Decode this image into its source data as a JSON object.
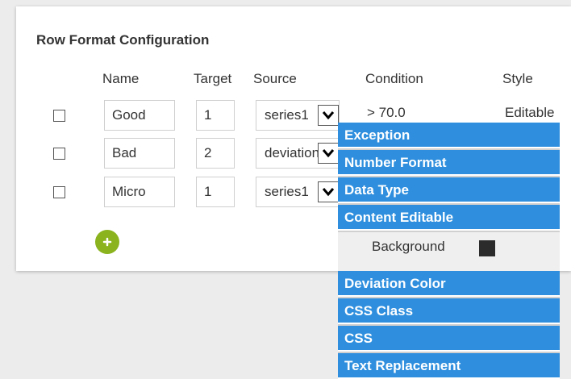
{
  "title": "Row Format Configuration",
  "columns": {
    "name": "Name",
    "target": "Target",
    "source": "Source",
    "condition": "Condition",
    "style": "Style"
  },
  "rows": [
    {
      "name": "Good",
      "target": "1",
      "source": "series1",
      "condition": "> 70.0",
      "style": "Editable"
    },
    {
      "name": "Bad",
      "target": "2",
      "source": "deviation"
    },
    {
      "name": "Micro",
      "target": "1",
      "source": "series1"
    }
  ],
  "style_menu": {
    "items": [
      "Exception",
      "Number Format",
      "Data Type",
      "Content Editable"
    ],
    "background_label": "Background",
    "background_color": "#2b2b2b",
    "items_after": [
      "Deviation Color",
      "CSS Class",
      "CSS",
      "Text Replacement"
    ]
  },
  "colors": {
    "accent": "#2f8fde",
    "add_button": "#8ab31d"
  }
}
